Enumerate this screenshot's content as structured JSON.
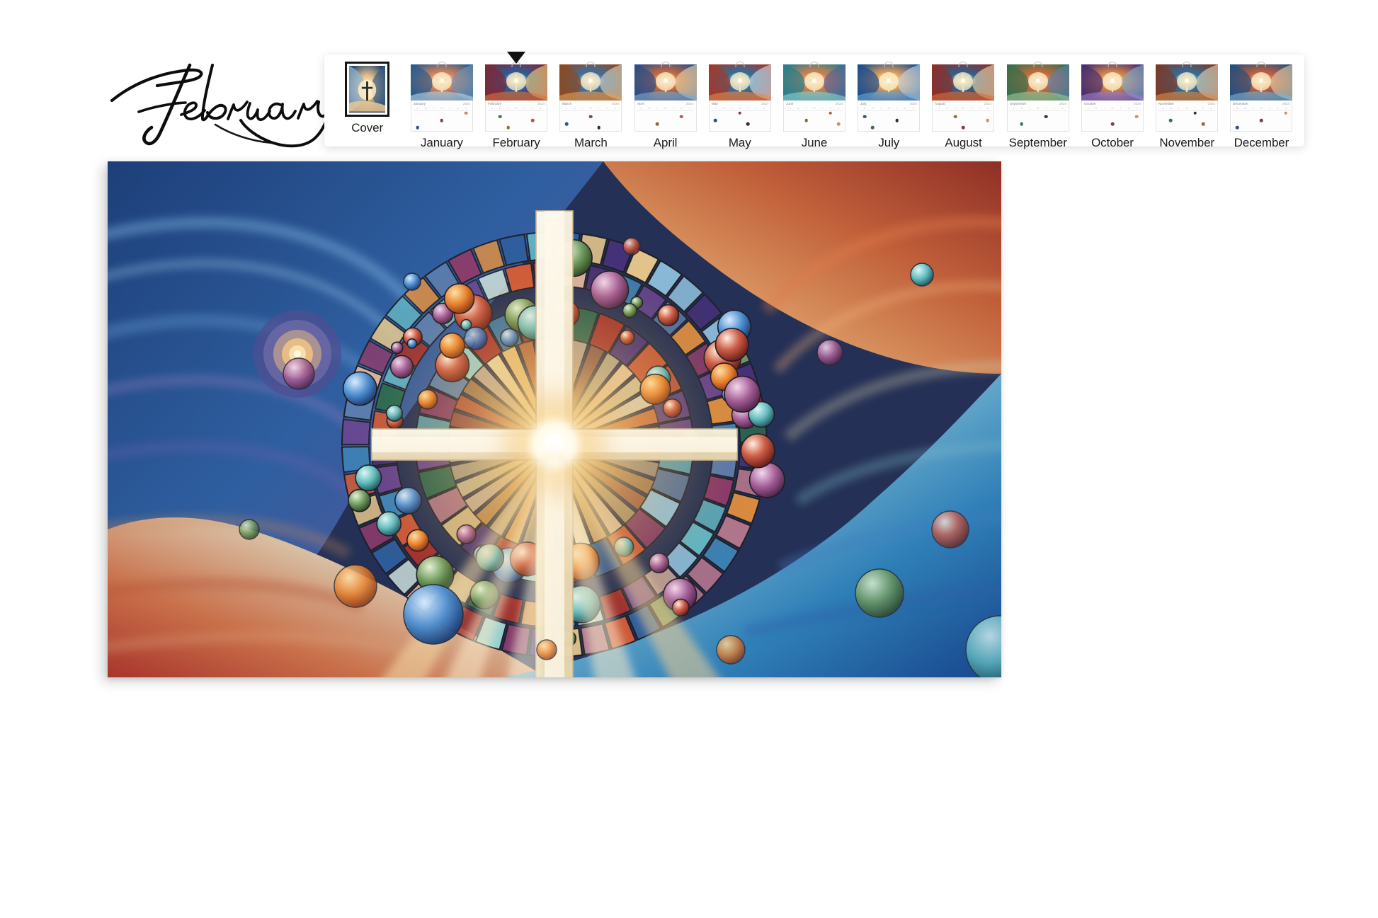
{
  "page": {
    "background_color": "#ffffff",
    "month_title": "February",
    "title_style": "handwritten-script"
  },
  "filmstrip": {
    "background_color": "#ffffff",
    "selected_index": 2,
    "selected_label": "February",
    "selection_marker": "down-triangle",
    "selection_marker_color": "#111111",
    "cover_frame_color": "#151515",
    "items": [
      {
        "label": "Cover",
        "type": "cover",
        "year": ""
      },
      {
        "label": "January",
        "type": "month",
        "year": "2024",
        "month_name": "January"
      },
      {
        "label": "February",
        "type": "month",
        "year": "2024",
        "month_name": "February"
      },
      {
        "label": "March",
        "type": "month",
        "year": "2024",
        "month_name": "March"
      },
      {
        "label": "April",
        "type": "month",
        "year": "2024",
        "month_name": "April"
      },
      {
        "label": "May",
        "type": "month",
        "year": "2024",
        "month_name": "May"
      },
      {
        "label": "June",
        "type": "month",
        "year": "2024",
        "month_name": "June"
      },
      {
        "label": "July",
        "type": "month",
        "year": "2024",
        "month_name": "July"
      },
      {
        "label": "August",
        "type": "month",
        "year": "2024",
        "month_name": "August"
      },
      {
        "label": "September",
        "type": "month",
        "year": "2024",
        "month_name": "September"
      },
      {
        "label": "October",
        "type": "month",
        "year": "2024",
        "month_name": "October"
      },
      {
        "label": "November",
        "type": "month",
        "year": "2024",
        "month_name": "November"
      },
      {
        "label": "December",
        "type": "month",
        "year": "2024",
        "month_name": "December"
      }
    ],
    "weekday_initials": [
      "S",
      "M",
      "T",
      "W",
      "T",
      "F",
      "S"
    ]
  },
  "artwork": {
    "subject": "stained-glass radiant cross mandala",
    "description": "Luminous stained-glass cross at the center of a circular mandala of colored glass tiles and glass orbs, surrounded by swirling waves of blue, purple, orange and red.",
    "center_glow_color": "#fff3c9",
    "cross_color": "#f5ecd0",
    "palette": [
      "#1f3f74",
      "#2e6fa8",
      "#43a7c2",
      "#8fd3d8",
      "#e9c98e",
      "#e8863c",
      "#c1382e",
      "#8e3b6b",
      "#4b2f6e",
      "#2a6b4f"
    ]
  }
}
